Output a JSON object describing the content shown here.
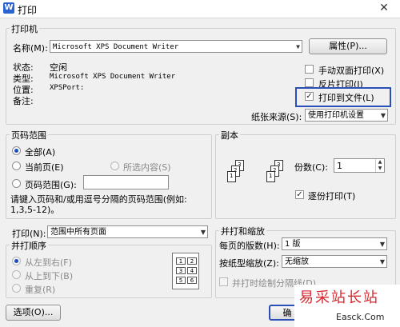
{
  "window": {
    "title": "打印",
    "close_glyph": "✕"
  },
  "printer": {
    "group_label": "打印机",
    "name_label": "名称(M):",
    "name_value": "Microsoft XPS Document Writer",
    "properties_button": "属性(P)...",
    "status_label": "状态:",
    "status_value": "空闲",
    "type_label": "类型:",
    "type_value": "Microsoft XPS Document Writer",
    "location_label": "位置:",
    "location_value": "XPSPort:",
    "comment_label": "备注:",
    "manual_duplex": {
      "label": "手动双面打印(X)",
      "checked": false
    },
    "reverse_print": {
      "label": "反片打印(I)",
      "checked": false
    },
    "print_to_file": {
      "label": "打印到文件(L)",
      "checked": true
    },
    "paper_source_label": "纸张来源(S):",
    "paper_source_value": "使用打印机设置"
  },
  "page_range": {
    "group_label": "页码范围",
    "all": {
      "label": "全部(A)",
      "checked": true
    },
    "current": {
      "label": "当前页(E)",
      "checked": false
    },
    "selection": {
      "label": "所选内容(S)",
      "checked": false,
      "disabled": true
    },
    "pages": {
      "label": "页码范围(G):",
      "checked": false,
      "value": ""
    },
    "hint_line1": "请键入页码和/或用逗号分隔的页码范围(例如:",
    "hint_line2": "1,3,5-12)。"
  },
  "copies": {
    "group_label": "副本",
    "count_label": "份数(C):",
    "count_value": "1",
    "collate": {
      "label": "逐份打印(T)",
      "checked": true
    },
    "page_icons": [
      "1",
      "2",
      "3",
      "1",
      "2",
      "3"
    ]
  },
  "print_what": {
    "label": "打印(N):",
    "value": "范围中所有页面"
  },
  "order": {
    "group_label": "并打顺序",
    "left_to_right": {
      "label": "从左到右(F)",
      "checked": true
    },
    "top_to_bottom": {
      "label": "从上到下(B)",
      "checked": false
    },
    "repeat": {
      "label": "重复(R)",
      "checked": false
    },
    "cells": [
      "1",
      "2",
      "3",
      "4",
      "5",
      "6"
    ]
  },
  "zoom": {
    "group_label": "并打和缩放",
    "pages_per_sheet_label": "每页的版数(H):",
    "pages_per_sheet_value": "1 版",
    "scale_label": "按纸型缩放(Z):",
    "scale_value": "无缩放",
    "draw_borders": {
      "label": "并打时绘制分隔线(D)",
      "checked": false
    }
  },
  "footer": {
    "options_button": "选项(O)...",
    "ok_button": "确"
  },
  "watermark": {
    "main": "易采站长站",
    "sub": "Easck.Com"
  },
  "colors": {
    "highlight": "#2b4fb8",
    "watermark_red": "#d6282f"
  }
}
